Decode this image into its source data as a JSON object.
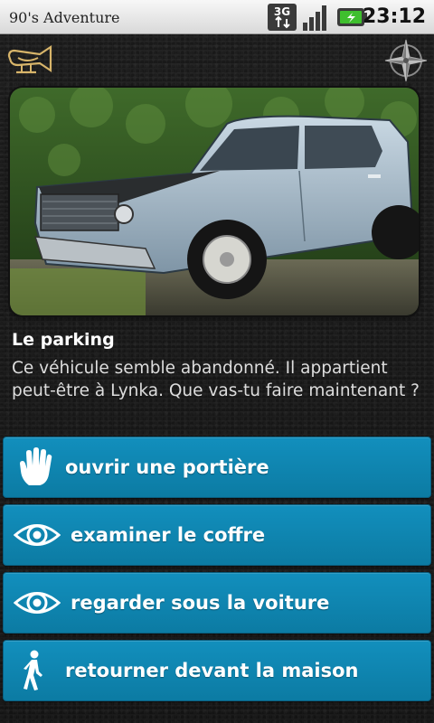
{
  "status_bar": {
    "app_title": "90's Adventure",
    "network": "3G",
    "time": "23:12",
    "icons": [
      "3g-icon",
      "signal-icon",
      "battery-charging-icon"
    ],
    "colors": {
      "battery": "#3fbf2e"
    }
  },
  "toolbar": {
    "left_icon": "horn-icon",
    "right_icon": "compass-icon"
  },
  "scene": {
    "image": "car-photo",
    "title": "Le parking",
    "description": "Ce véhicule semble abandonné. Il appartient peut-être à Lynka. Que vas-tu faire maintenant ?"
  },
  "actions": [
    {
      "icon": "hand-icon",
      "label": "ouvrir une portière"
    },
    {
      "icon": "eye-icon",
      "label": "examiner le coffre"
    },
    {
      "icon": "eye-icon",
      "label": "regarder sous la voiture"
    },
    {
      "icon": "walking-person-icon",
      "label": "retourner devant la maison"
    }
  ],
  "colors": {
    "button_bg": "#0f86b2",
    "background": "#1c1c1c",
    "text": "#ffffff"
  }
}
